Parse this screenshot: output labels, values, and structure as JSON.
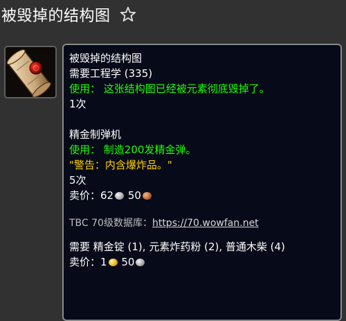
{
  "header": {
    "title": "被毁掉的结构图"
  },
  "icons": {
    "favorite": "star-outline-icon",
    "item": "scroll-blueprint-icon"
  },
  "tooltip": {
    "item_name": "被毁掉的结构图",
    "requirement": "需要工程学 (335)",
    "use_line": "使用： 这张结构图已经被元素彻底毁掉了。",
    "charges": "1次",
    "recipe": {
      "name": "精金制弹机",
      "use_line": "使用： 制造200发精金弹。",
      "warning": "\"警告：内含爆炸品。\"",
      "charges": "5次",
      "sell_label": "卖价：",
      "sell_silver": "62",
      "sell_copper": "50"
    },
    "source": {
      "label": "TBC 70级数据库：",
      "link": "https://70.wowfan.net"
    },
    "reagents": "需要 精金锭 (1), 元素炸药粉 (2), 普通木柴 (4)",
    "sell2": {
      "label": "卖价：",
      "gold": "1",
      "silver": "50"
    }
  },
  "colors": {
    "background": "#313131",
    "tooltip_bg": "#070a18",
    "use_text": "#1eff00",
    "warning_text": "#ffd100"
  }
}
